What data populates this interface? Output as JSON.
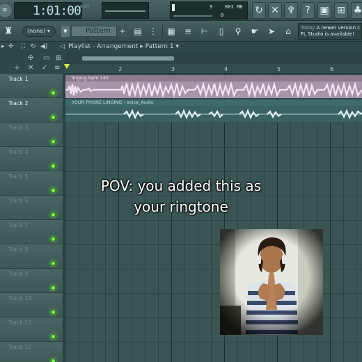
{
  "transport": {
    "time": "1:01:00",
    "time_label": "B:S:T"
  },
  "perf": {
    "cpu": "9",
    "memory": "801 MB",
    "polyphony": "0"
  },
  "toolbar2": {
    "preset": "(none)",
    "pattern": "Pattern 1",
    "pattern_add": "+",
    "news_line1_prefix": "Today",
    "news_line1": "A newer version c",
    "news_line2": "FL Studio is available!"
  },
  "playlist": {
    "title": "Playlist - Arrangement",
    "pattern": "Pattern 1",
    "ruler": [
      "2",
      "3",
      "4",
      "5",
      "6"
    ]
  },
  "tracks": [
    {
      "name": "Track 1"
    },
    {
      "name": "Track 2"
    },
    {
      "name": "Track 3"
    },
    {
      "name": "Track 4"
    },
    {
      "name": "Track 5"
    },
    {
      "name": "Track 6"
    },
    {
      "name": "Track 7"
    },
    {
      "name": "Track 8"
    },
    {
      "name": "Track 9"
    },
    {
      "name": "Track 10"
    },
    {
      "name": "Track 11"
    },
    {
      "name": "Track 12"
    }
  ],
  "clips": {
    "clip1": "linging bpm 146",
    "clip2": "YOUR PHONE LINGING - Voice_Audio"
  },
  "overlay": {
    "caption_line1": "POV: you added this as",
    "caption_line2": "your ringtone"
  },
  "colors": {
    "accent_led": "#79ff4a",
    "clip1": "#a795a8",
    "clip2": "#3b6160"
  }
}
